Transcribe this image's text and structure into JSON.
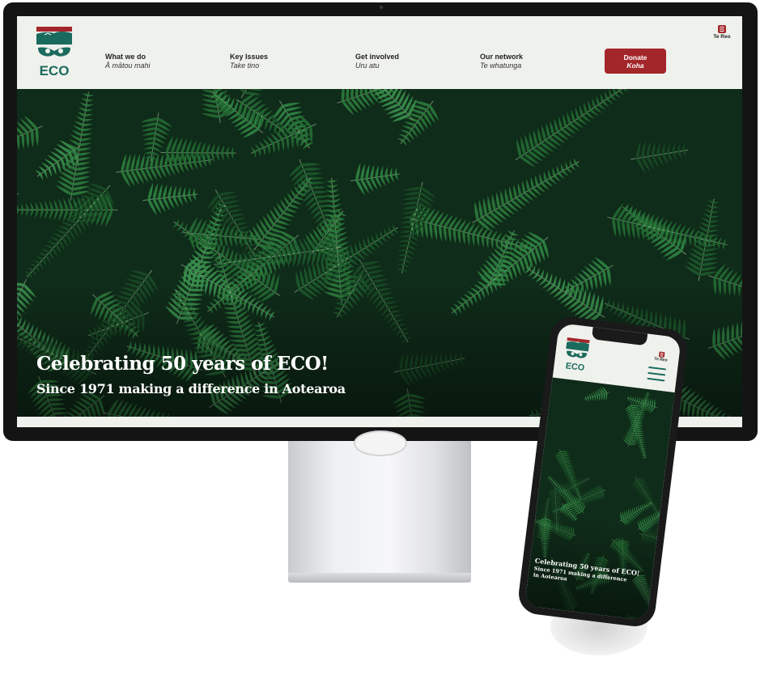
{
  "site": {
    "logo_text": "ECO",
    "nav": [
      {
        "en": "What we do",
        "mi": "Ā mātou mahi"
      },
      {
        "en": "Key Issues",
        "mi": "Take tino"
      },
      {
        "en": "Get involved",
        "mi": "Uru atu"
      },
      {
        "en": "Our network",
        "mi": "Te whatunga"
      }
    ],
    "donate": {
      "en": "Donate",
      "mi": "Koha"
    },
    "language_toggle": "Te Reo",
    "hero": {
      "title": "Celebrating 50 years of ECO!",
      "subtitle": "Since 1971 making a difference in Aotearoa"
    }
  },
  "mobile": {
    "logo_text": "ECO",
    "language_toggle": "Te Reo",
    "hero_title": "Celebrating 50 years of ECO!",
    "hero_subtitle": "Since 1971 making a difference in Aotearoa"
  },
  "colors": {
    "brand_red": "#a3262a",
    "brand_teal": "#1b6a5e",
    "header_bg": "#eff1ec",
    "hero_fern_dark": "#0f2b19"
  }
}
